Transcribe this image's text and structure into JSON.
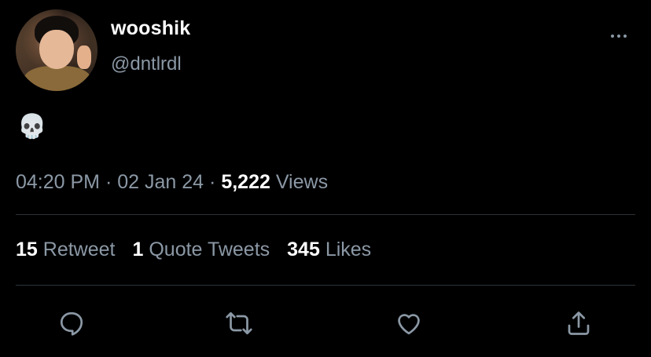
{
  "author": {
    "display_name": "wooshik",
    "handle": "@dntlrdl"
  },
  "tweet": {
    "text": "💀"
  },
  "meta": {
    "time": "04:20 PM",
    "sep1": "·",
    "date": "02 Jan 24",
    "sep2": "·",
    "views_count": "5,222",
    "views_label": "Views"
  },
  "stats": {
    "retweets_count": "15",
    "retweets_label": "Retweet",
    "quotes_count": "1",
    "quotes_label": "Quote Tweets",
    "likes_count": "345",
    "likes_label": "Likes"
  },
  "icons": {
    "more": "more-horizontal-icon",
    "reply": "reply-icon",
    "retweet": "retweet-icon",
    "like": "heart-icon",
    "share": "share-icon"
  },
  "colors": {
    "background": "#000000",
    "primary_text": "#ffffff",
    "secondary_text": "#8b98a5",
    "divider": "#2f3336"
  }
}
